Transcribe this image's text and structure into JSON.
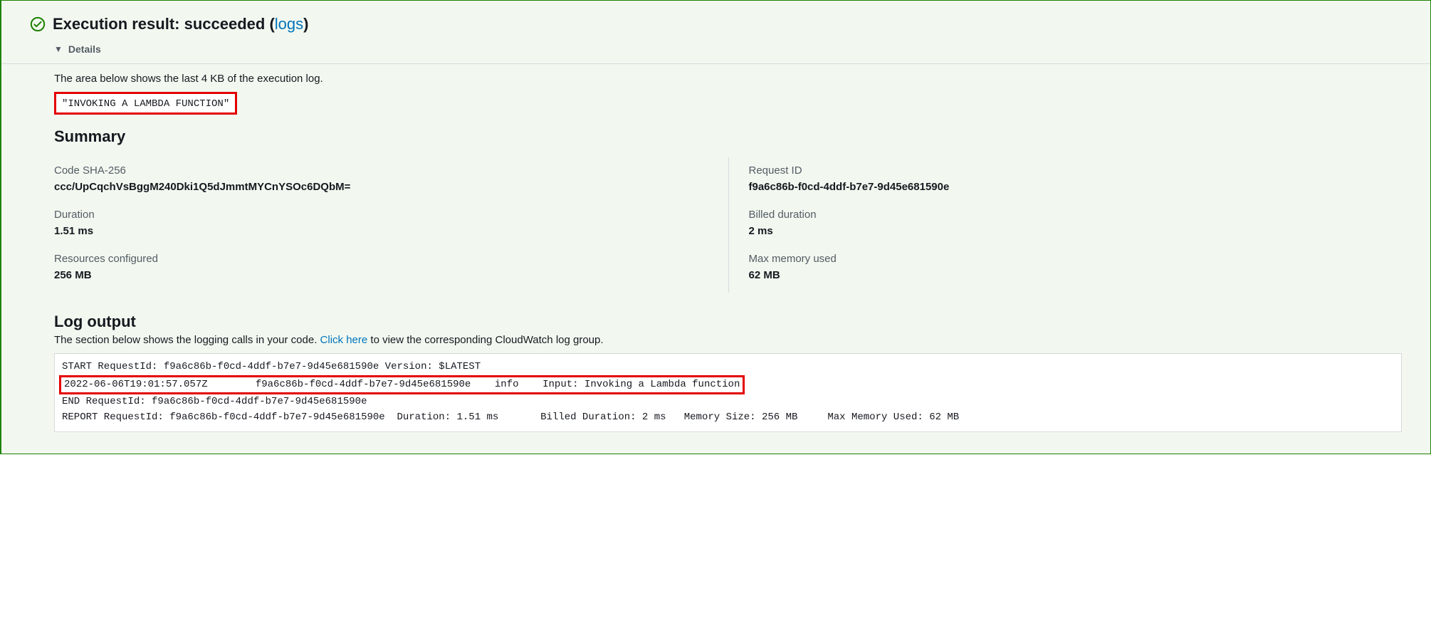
{
  "header": {
    "title_prefix": "Execution result: ",
    "status": "succeeded",
    "logs_open": " (",
    "logs_link": "logs",
    "logs_close": ")"
  },
  "details": {
    "label": "Details"
  },
  "intro": "The area below shows the last 4 KB of the execution log.",
  "result_output": "\"INVOKING A LAMBDA FUNCTION\"",
  "summary": {
    "title": "Summary",
    "left": [
      {
        "label": "Code SHA-256",
        "value": "ccc/UpCqchVsBggM240Dki1Q5dJmmtMYCnYSOc6DQbM="
      },
      {
        "label": "Duration",
        "value": "1.51 ms"
      },
      {
        "label": "Resources configured",
        "value": "256 MB"
      }
    ],
    "right": [
      {
        "label": "Request ID",
        "value": "f9a6c86b-f0cd-4ddf-b7e7-9d45e681590e"
      },
      {
        "label": "Billed duration",
        "value": "2 ms"
      },
      {
        "label": "Max memory used",
        "value": "62 MB"
      }
    ]
  },
  "log": {
    "title": "Log output",
    "intro_prefix": "The section below shows the logging calls in your code. ",
    "click_here": "Click here",
    "intro_suffix": " to view the corresponding CloudWatch log group.",
    "lines": {
      "l0": "START RequestId: f9a6c86b-f0cd-4ddf-b7e7-9d45e681590e Version: $LATEST",
      "l1": "2022-06-06T19:01:57.057Z        f9a6c86b-f0cd-4ddf-b7e7-9d45e681590e    info    Input: Invoking a Lambda function",
      "l2": "END RequestId: f9a6c86b-f0cd-4ddf-b7e7-9d45e681590e",
      "l3": "REPORT RequestId: f9a6c86b-f0cd-4ddf-b7e7-9d45e681590e  Duration: 1.51 ms       Billed Duration: 2 ms   Memory Size: 256 MB     Max Memory Used: 62 MB"
    }
  }
}
